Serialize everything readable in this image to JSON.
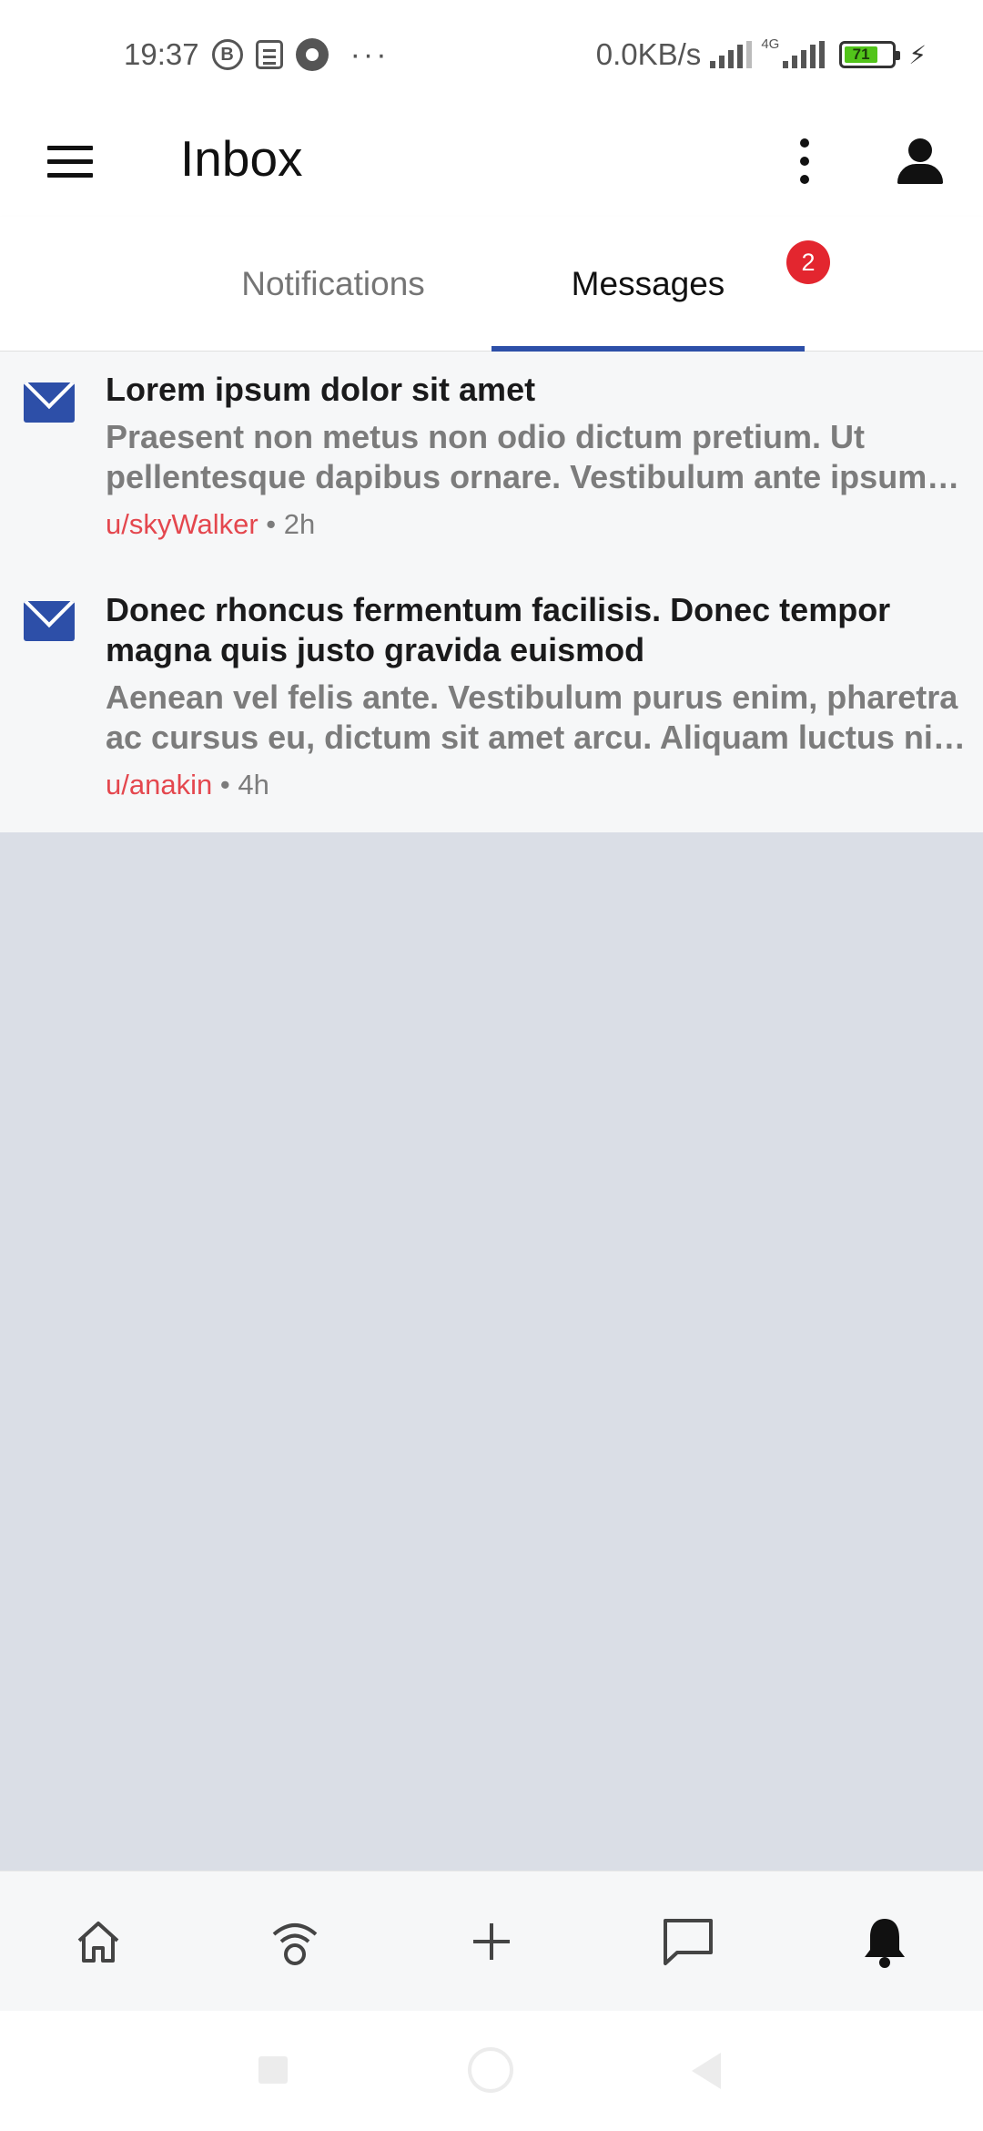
{
  "status_bar": {
    "time": "19:37",
    "b_badge": "B",
    "dots": "···",
    "net_speed": "0.0KB/s",
    "network_type": "4G",
    "battery_level": "71",
    "icons": [
      "b-circle-icon",
      "news-icon",
      "gear-icon",
      "signal-icon",
      "battery-icon",
      "charging-icon"
    ]
  },
  "app_bar": {
    "title": "Inbox",
    "icons": [
      "menu-icon",
      "more-options-icon",
      "account-icon"
    ]
  },
  "tabs": {
    "items": [
      {
        "label": "Notifications",
        "active": false
      },
      {
        "label": "Messages",
        "active": true
      }
    ],
    "messages_badge": "2",
    "accent_color": "#2d4fa8",
    "badge_color": "#e3262f"
  },
  "messages": [
    {
      "title": "Lorem ipsum dolor sit amet",
      "preview": "Praesent non metus non odio dictum pretium. Ut pellentesque dapibus ornare. Vestibulum ante ipsum primis in faucibus orci luctus et ultrices posuere cubilia curae.",
      "author": "u/skyWalker",
      "separator": "•",
      "time": "2h"
    },
    {
      "title": "Donec rhoncus fermentum facilisis. Donec tempor magna quis justo gravida euismod",
      "preview": "Aenean vel felis ante. Vestibulum purus enim, pharetra ac cursus eu, dictum sit amet arcu. Aliquam luctus nisl a erat facilisis, vitae tincidunt mauris.",
      "author": "u/anakin",
      "separator": "•",
      "time": "4h"
    }
  ],
  "bottom_nav": {
    "items": [
      "home-icon",
      "popular-icon",
      "create-post-icon",
      "chat-icon",
      "inbox-bell-icon"
    ],
    "active": "inbox-bell-icon"
  },
  "colors": {
    "author": "#e4474e",
    "mail_icon": "#2d4fa8",
    "empty_area": "#dadee6"
  }
}
